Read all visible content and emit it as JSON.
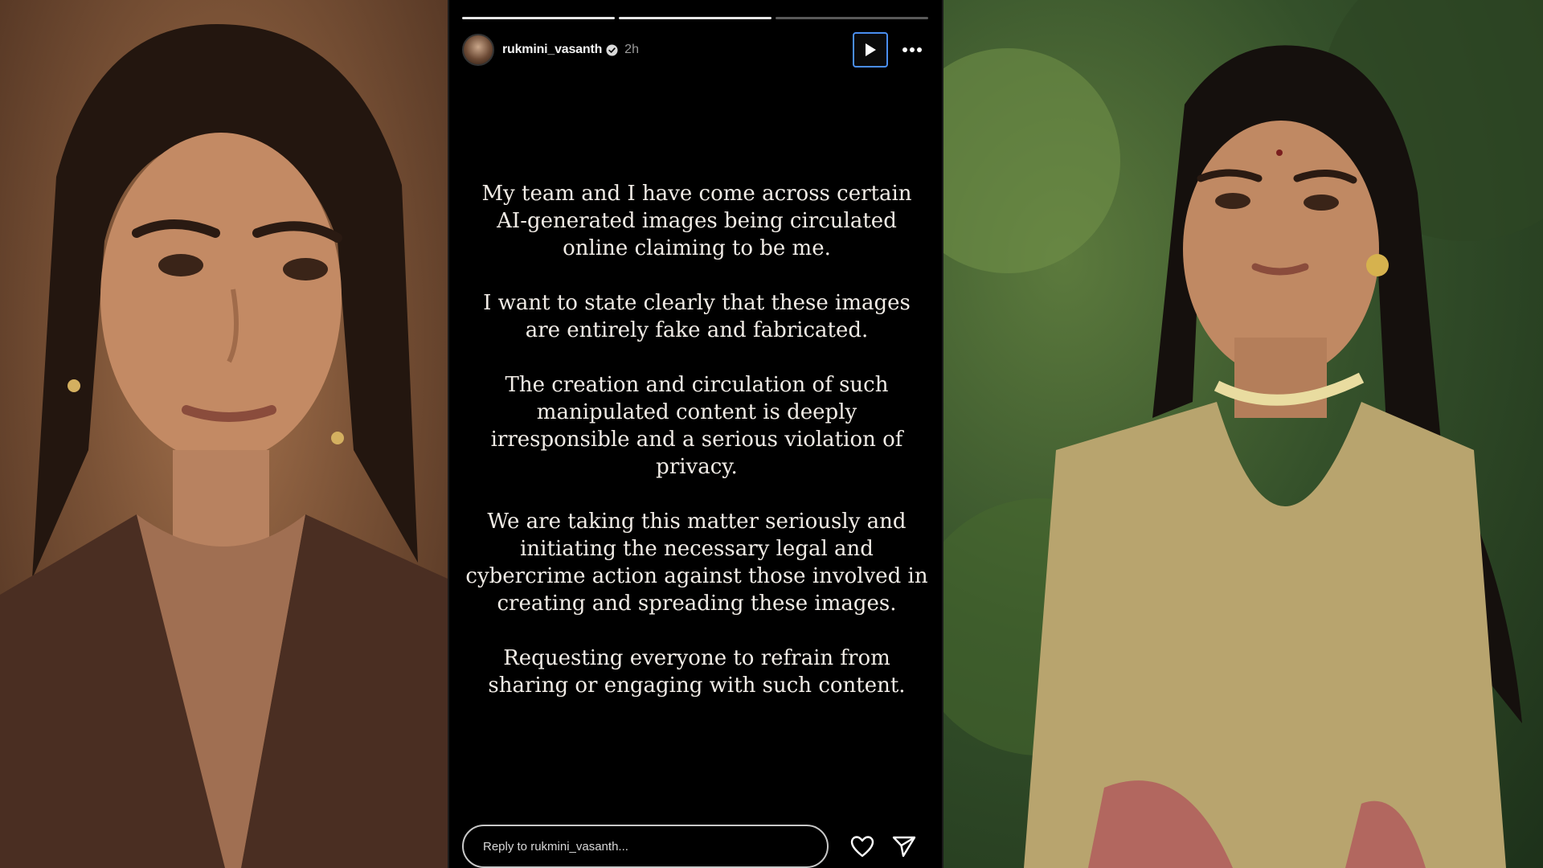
{
  "story": {
    "progress": [
      1.0,
      1.0,
      0.0
    ],
    "username": "rukmini_vasanth",
    "time_ago": "2h",
    "paragraphs": [
      "My team and I have come across certain AI-generated images being circulated online claiming to be me.",
      "I want to state clearly that these images are entirely fake and fabricated.",
      "The creation and circulation of such manipulated content is deeply irresponsible and a serious violation of privacy.",
      "We are taking this matter seriously and initiating the necessary legal and cybercrime action against those involved in creating and spreading these images.",
      "Requesting everyone to refrain from sharing or engaging with such content."
    ],
    "reply_placeholder": "Reply to rukmini_vasanth...",
    "icons": {
      "verified": "verified-badge-icon",
      "play": "play-icon",
      "more": "more-dots-icon",
      "like": "heart-icon",
      "share": "send-icon"
    }
  },
  "colors": {
    "accent": "#4a8ef0",
    "story_background": "#000000",
    "text": "#f1ece6"
  }
}
